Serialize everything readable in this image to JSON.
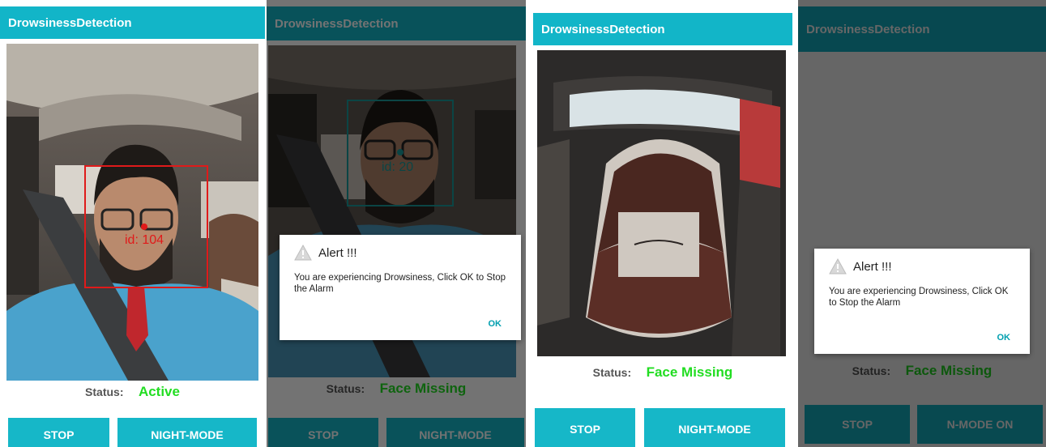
{
  "app_title": "DrowsinessDetection",
  "colors": {
    "appbar_active": "#12b5c8",
    "appbar_dimmed": "#0a5b62",
    "button": "#16b7c8",
    "status_value": "#22dd22",
    "face_box_active": "#e01a1a",
    "face_box_drowsy": "#1a9a9a"
  },
  "screens": [
    {
      "status_label": "Status:",
      "status_value": "Active",
      "face_id": "id: 104",
      "buttons": {
        "stop": "STOP",
        "night_mode": "NIGHT-MODE"
      }
    },
    {
      "status_label": "Status:",
      "status_value": "Face Missing",
      "face_id": "id: 20",
      "buttons": {
        "stop": "STOP",
        "night_mode": "NIGHT-MODE"
      },
      "dialog": {
        "icon": "warning-icon",
        "title": "Alert !!!",
        "message": "You are experiencing Drowsiness, Click OK to Stop the Alarm",
        "ok": "OK"
      }
    },
    {
      "status_label": "Status:",
      "status_value": "Face Missing",
      "buttons": {
        "stop": "STOP",
        "night_mode": "NIGHT-MODE"
      }
    },
    {
      "status_label": "Status:",
      "status_value": "Face Missing",
      "buttons": {
        "stop": "STOP",
        "night_mode": "N-MODE ON"
      },
      "dialog": {
        "icon": "warning-icon",
        "title": "Alert !!!",
        "message": "You are experiencing Drowsiness, Click OK to Stop the Alarm",
        "ok": "OK"
      }
    }
  ]
}
